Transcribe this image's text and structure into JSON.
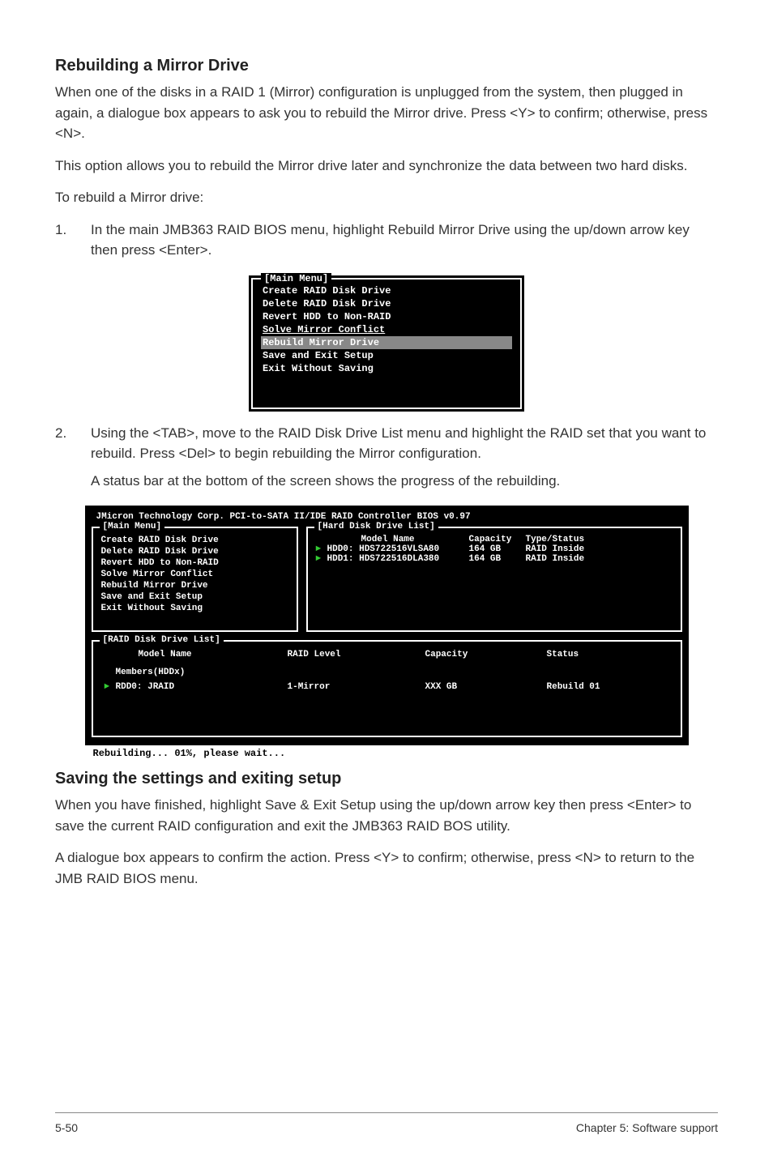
{
  "section1": {
    "heading": "Rebuilding a Mirror Drive",
    "p1": "When one of the disks in a RAID 1 (Mirror) configuration is unplugged from the system, then plugged in again, a dialogue box appears to ask you to rebuild the Mirror drive. Press <Y> to confirm; otherwise, press <N>.",
    "p2": "This option allows you to rebuild the Mirror drive later and synchronize the data between two hard disks.",
    "p3": "To rebuild a Mirror drive:",
    "step1_num": "1.",
    "step1": "In the main JMB363 RAID BIOS menu, highlight Rebuild Mirror Drive using the up/down arrow key then press <Enter>.",
    "step2_num": "2.",
    "step2a": "Using the <TAB>, move to the RAID Disk Drive List menu and highlight the RAID set that you want to rebuild. Press <Del> to begin rebuilding the Mirror configuration.",
    "step2b": "A status bar at the bottom of the screen shows the progress of the rebuilding."
  },
  "bios_small": {
    "title": "[Main Menu]",
    "items": [
      "Create RAID Disk Drive",
      "Delete RAID Disk Drive",
      "Revert HDD to Non-RAID",
      "Solve Mirror Conflict",
      "Rebuild Mirror Drive",
      "Save and Exit Setup",
      "Exit Without Saving"
    ],
    "highlight_index": 4,
    "underline_index": 3
  },
  "bios_large": {
    "header": "JMicron Technology Corp. PCI-to-SATA II/IDE RAID Controller BIOS v0.97",
    "main_menu_title": "[Main Menu]",
    "main_menu_items": [
      "Create RAID Disk Drive",
      "Delete RAID Disk Drive",
      "Revert HDD to Non-RAID",
      "Solve Mirror Conflict",
      "Rebuild Mirror Drive",
      "Save and Exit Setup",
      "Exit Without Saving"
    ],
    "hdd_list_title": "[Hard Disk Drive List]",
    "hdd_headers": {
      "model": "Model Name",
      "capacity": "Capacity",
      "type": "Type/Status"
    },
    "hdd_rows": [
      {
        "label": "HDD0: HDS722516VLSA80",
        "cap": "164 GB",
        "type": "RAID Inside"
      },
      {
        "label": "HDD1: HDS722516DLA380",
        "cap": "164 GB",
        "type": "RAID Inside"
      }
    ],
    "raid_list_title": "[RAID Disk Drive List]",
    "raid_headers": {
      "model": "Model Name",
      "level": "RAID Level",
      "capacity": "Capacity",
      "status": "Status"
    },
    "members_label": "Members(HDDx)",
    "raid_row": {
      "name": "RDD0:  JRAID",
      "level": "1-Mirror",
      "cap": "XXX GB",
      "status": "Rebuild  01"
    },
    "status_bar": " Rebuilding... 01%, please wait..."
  },
  "section2": {
    "heading": "Saving the settings and exiting setup",
    "p1": "When you have finished, highlight Save & Exit Setup using the up/down arrow key then press <Enter> to save the current RAID configuration and exit the JMB363 RAID BOS utility.",
    "p2": "A dialogue box appears to confirm the action. Press <Y> to confirm; otherwise, press <N> to return to the JMB RAID BIOS menu."
  },
  "footer": {
    "left": "5-50",
    "right": "Chapter 5: Software support"
  }
}
